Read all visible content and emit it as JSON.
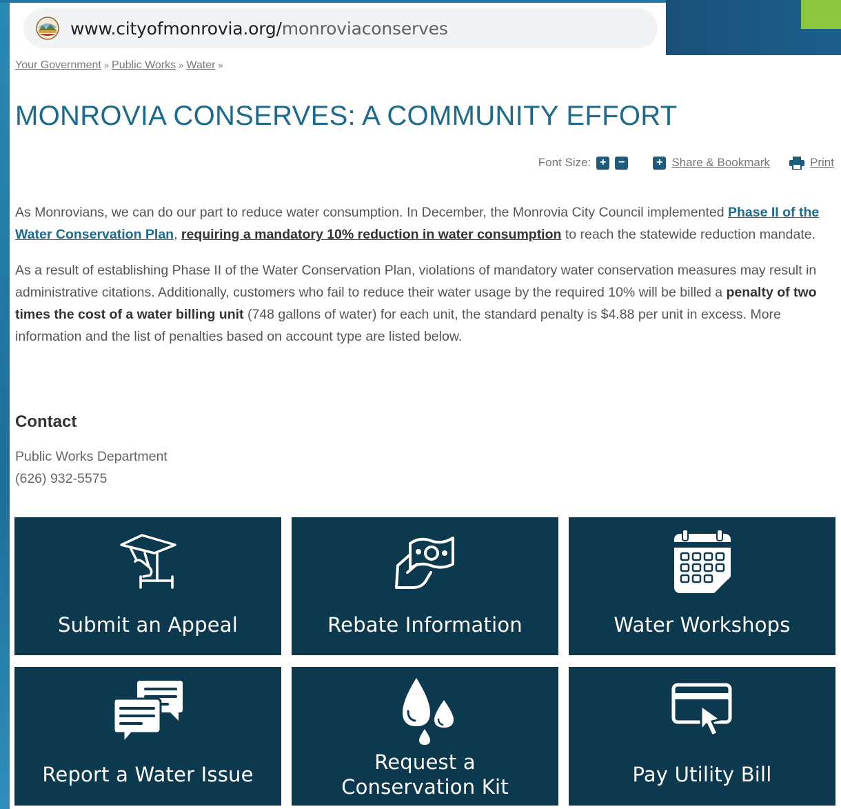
{
  "browser": {
    "url_domain": "www.cityofmonrovia.org/",
    "url_path": "monroviaconserves",
    "site_icon": "city-seal-icon"
  },
  "breadcrumb": {
    "items": [
      "Your Government",
      "Public Works",
      "Water"
    ],
    "separator": "»"
  },
  "page": {
    "title": "MONROVIA CONSERVES: A COMMUNITY EFFORT"
  },
  "tools": {
    "font_size_label": "Font Size:",
    "increase_symbol": "+",
    "decrease_symbol": "−",
    "share_symbol": "+",
    "share_label": "Share & Bookmark",
    "print_label": "Print"
  },
  "paragraph1": {
    "text_a": "As Monrovians, we can do our part to reduce water consumption. In December, the Monrovia City Council implemented ",
    "link1": "Phase II of the Water Conservation Plan",
    "text_b": ", ",
    "link2": "requiring a mandatory 10% reduction in water consumption",
    "text_c": " to reach the statewide reduction mandate."
  },
  "paragraph2": {
    "text_a": " As a result of establishing Phase II of the Water Conservation Plan, violations of mandatory water conservation measures may result in administrative citations. Additionally, customers who fail to reduce their water usage by the required 10% will be billed a ",
    "bold": "penalty of two times the cost of a water billing unit",
    "text_b": " (748 gallons of water) for each unit, the standard penalty is $4.88 per unit in excess. More information and the list of penalties based on account type are listed below."
  },
  "contact": {
    "heading": "Contact",
    "department": "Public Works Department",
    "phone": "(626) 932-5575"
  },
  "tiles": [
    {
      "label": "Submit an Appeal",
      "icon": "gavel-hand-icon"
    },
    {
      "label": "Rebate Information",
      "icon": "money-hand-icon"
    },
    {
      "label": "Water Workshops",
      "icon": "calendar-icon"
    },
    {
      "label": "Report a Water Issue",
      "icon": "chat-bubbles-icon"
    },
    {
      "label": "Request a Conservation Kit",
      "icon": "water-drops-icon"
    },
    {
      "label": "Pay Utility Bill",
      "icon": "credit-card-click-icon"
    }
  ],
  "colors": {
    "title": "#1c6a8e",
    "tile_bg": "#0d394f",
    "accent_green": "#8cc63f",
    "backdrop": "#1d6e96"
  }
}
